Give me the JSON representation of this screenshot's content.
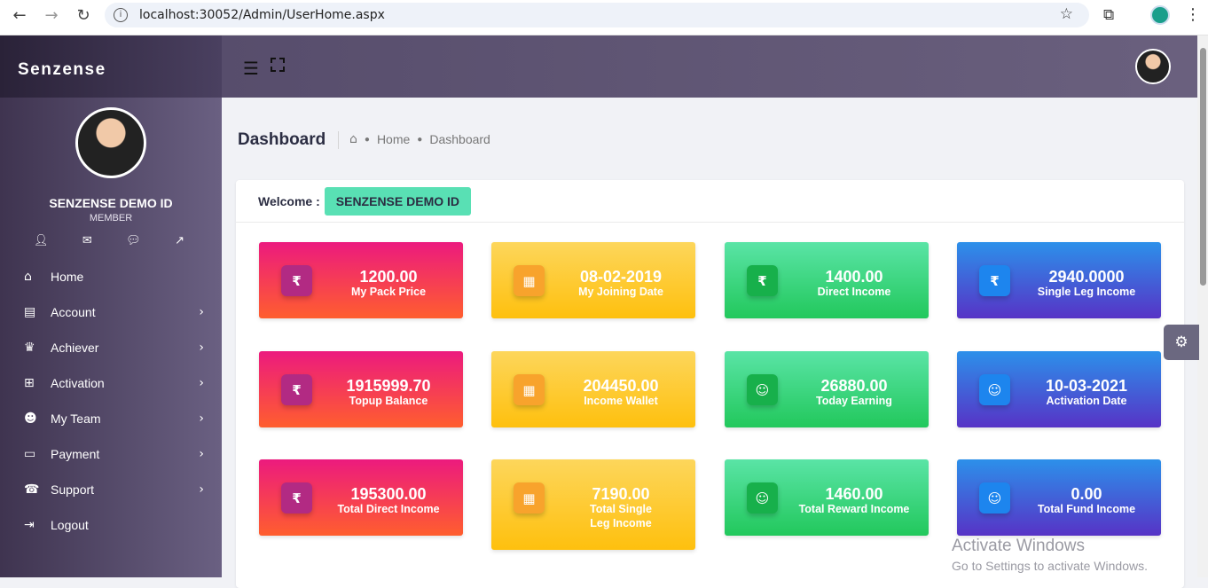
{
  "browser": {
    "url": "localhost:30052/Admin/UserHome.aspx",
    "back": "←",
    "forward": "→",
    "reload": "↻"
  },
  "brand": "Senzense",
  "user": {
    "name": "SENZENSE DEMO ID",
    "role": "MEMBER"
  },
  "menu": [
    {
      "label": "Home",
      "icon": "home-icon",
      "glyph": "⌂",
      "has_submenu": false
    },
    {
      "label": "Account",
      "icon": "book-icon",
      "glyph": "▤",
      "has_submenu": true
    },
    {
      "label": "Achiever",
      "icon": "crown-icon",
      "glyph": "♛",
      "has_submenu": true
    },
    {
      "label": "Activation",
      "icon": "grid-icon",
      "glyph": "⊞",
      "has_submenu": true
    },
    {
      "label": "My Team",
      "icon": "users-icon",
      "glyph": "☻",
      "has_submenu": true
    },
    {
      "label": "Payment",
      "icon": "card-icon",
      "glyph": "▭",
      "has_submenu": true
    },
    {
      "label": "Support",
      "icon": "support-icon",
      "glyph": "☎",
      "has_submenu": true
    },
    {
      "label": "Logout",
      "icon": "logout-icon",
      "glyph": "⇥",
      "has_submenu": false
    }
  ],
  "header": {
    "title": "Dashboard",
    "breadcrumb": [
      "Home",
      "Dashboard"
    ]
  },
  "welcome": {
    "label": "Welcome :",
    "name": "SENZENSE DEMO ID"
  },
  "cards": [
    {
      "value": "1200.00",
      "label": "My Pack Price",
      "color": "pink",
      "icon": "rupee-icon",
      "glyph": "₹"
    },
    {
      "value": "08-02-2019",
      "label": "My Joining Date",
      "color": "yellow",
      "icon": "calendar-icon",
      "glyph": "▦"
    },
    {
      "value": "1400.00",
      "label": "Direct Income",
      "color": "green",
      "icon": "rupee-icon",
      "glyph": "₹"
    },
    {
      "value": "2940.0000",
      "label": "Single Leg Income",
      "color": "blue",
      "icon": "rupee-icon",
      "glyph": "₹"
    },
    {
      "value": "1915999.70",
      "label": "Topup Balance",
      "color": "pink",
      "icon": "rupee-icon",
      "glyph": "₹"
    },
    {
      "value": "204450.00",
      "label": "Income Wallet",
      "color": "yellow",
      "icon": "calendar-icon",
      "glyph": "▦"
    },
    {
      "value": "26880.00",
      "label": "Today Earning",
      "color": "green",
      "icon": "user-plus-icon",
      "glyph": "☺"
    },
    {
      "value": "10-03-2021",
      "label": "Activation Date",
      "color": "blue",
      "icon": "user-plus-icon",
      "glyph": "☺"
    },
    {
      "value": "195300.00",
      "label": "Total Direct Income",
      "color": "pink",
      "icon": "rupee-icon",
      "glyph": "₹"
    },
    {
      "value": "7190.00",
      "label": "Total Single Leg Income",
      "color": "yellow",
      "icon": "calendar-icon",
      "glyph": "▦"
    },
    {
      "value": "1460.00",
      "label": "Total Reward Income",
      "color": "green",
      "icon": "user-plus-icon",
      "glyph": "☺"
    },
    {
      "value": "0.00",
      "label": "Total Fund Income",
      "color": "blue",
      "icon": "user-plus-icon",
      "glyph": "☺"
    }
  ],
  "watermark": {
    "line1": "Activate Windows",
    "line2": "Go to Settings to activate Windows."
  }
}
